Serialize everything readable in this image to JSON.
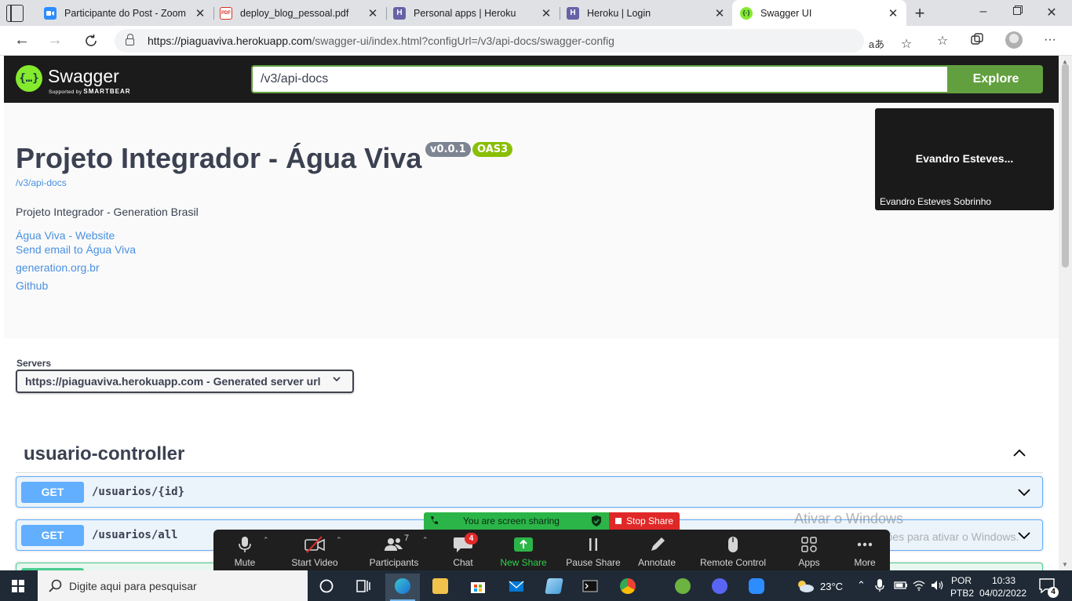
{
  "browser": {
    "tabs": [
      {
        "title": "Participante do Post - Zoom",
        "icon": "zoom-icon",
        "color": "#2d8cff"
      },
      {
        "title": "deploy_blog_pessoal.pdf",
        "icon": "pdf-icon",
        "color": "#d93025"
      },
      {
        "title": "Personal apps | Heroku",
        "icon": "heroku-icon",
        "color": "#6762a6"
      },
      {
        "title": "Heroku | Login",
        "icon": "heroku-icon",
        "color": "#6762a6"
      },
      {
        "title": "Swagger UI",
        "icon": "swagger-icon",
        "color": "#85ea2d",
        "active": true
      }
    ],
    "url_host": "https://piaguaviva.herokuapp.com",
    "url_path": "/swagger-ui/index.html?configUrl=/v3/api-docs/swagger-config"
  },
  "swagger": {
    "logo_name": "Swagger",
    "logo_supported": "Supported by",
    "logo_brand": "SMARTBEAR",
    "spec_url_value": "/v3/api-docs",
    "explore_label": "Explore",
    "title": "Projeto Integrador - Água Viva",
    "version": "v0.0.1",
    "oas": "OAS3",
    "spec_link": "/v3/api-docs",
    "description": "Projeto Integrador - Generation Brasil",
    "links": [
      "Água Viva - Website",
      "Send email to Água Viva",
      "generation.org.br",
      "Github"
    ],
    "servers_label": "Servers",
    "server_selected": "https://piaguaviva.herokuapp.com - Generated server url",
    "tag": "usuario-controller",
    "operations": [
      {
        "method": "GET",
        "path": "/usuarios/{id}"
      },
      {
        "method": "GET",
        "path": "/usuarios/all"
      }
    ],
    "colors": {
      "get": "#61affe",
      "post": "#49cc90",
      "accent": "#62a03f",
      "topbar": "#1b1b1b"
    }
  },
  "zoom": {
    "video_name_center": "Evandro  Esteves...",
    "video_name_label": "Evandro Esteves Sobrinho",
    "sharing_text": "You are screen sharing",
    "stop_share": "Stop Share",
    "toolbar": [
      {
        "label": "Mute",
        "icon": "microphone-icon"
      },
      {
        "label": "Start Video",
        "icon": "video-off-icon"
      },
      {
        "label": "Participants",
        "icon": "participants-icon"
      },
      {
        "label": "Chat",
        "icon": "chat-icon"
      },
      {
        "label": "New Share",
        "icon": "share-arrow-icon"
      },
      {
        "label": "Pause Share",
        "icon": "pause-icon"
      },
      {
        "label": "Annotate",
        "icon": "pencil-icon"
      },
      {
        "label": "Remote Control",
        "icon": "mouse-icon"
      },
      {
        "label": "Apps",
        "icon": "apps-icon"
      },
      {
        "label": "More",
        "icon": "more-icon"
      }
    ],
    "participants_count": "7",
    "chat_badge": "4"
  },
  "windows": {
    "activate_title": "Ativar o Windows",
    "activate_sub": "Acesse Configurações para ativar o Windows.",
    "search_placeholder": "Digite aqui para pesquisar",
    "temperature": "23°C",
    "lang_1": "POR",
    "lang_2": "PTB2",
    "time": "10:33",
    "date": "04/02/2022",
    "notifications": "4"
  }
}
